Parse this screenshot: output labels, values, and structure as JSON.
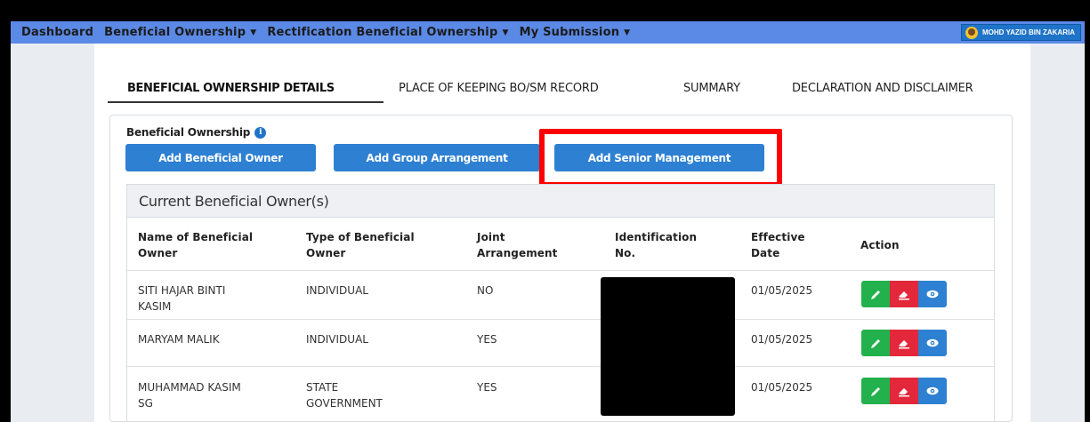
{
  "nav": {
    "items": [
      {
        "label": "Dashboard",
        "dropdown": false
      },
      {
        "label": "Beneficial Ownership",
        "dropdown": true
      },
      {
        "label": "Rectification Beneficial Ownership",
        "dropdown": true
      },
      {
        "label": "My Submission",
        "dropdown": true
      }
    ],
    "user_name": "MOHD YAZID BIN ZAKARIA"
  },
  "tabs": [
    {
      "label": "BENEFICIAL OWNERSHIP DETAILS",
      "active": true
    },
    {
      "label": "PLACE OF KEEPING BO/SM RECORD",
      "active": false
    },
    {
      "label": "SUMMARY",
      "active": false
    },
    {
      "label": "DECLARATION AND DISCLAIMER",
      "active": false
    }
  ],
  "section": {
    "title": "Beneficial Ownership",
    "info_icon": "info-icon",
    "buttons": {
      "add_owner": "Add Beneficial Owner",
      "add_group": "Add Group Arrangement",
      "add_senior": "Add Senior Management"
    }
  },
  "table": {
    "title": "Current Beneficial Owner(s)",
    "headers": {
      "name": [
        "Name of Beneficial",
        "Owner"
      ],
      "type": [
        "Type of Beneficial",
        "Owner"
      ],
      "joint": [
        "Joint",
        "Arrangement"
      ],
      "id": [
        "Identification",
        "No."
      ],
      "date": [
        "Effective",
        "Date"
      ],
      "action": "Action"
    },
    "rows": [
      {
        "name": [
          "SITI HAJAR BINTI",
          "KASIM"
        ],
        "type": [
          "INDIVIDUAL",
          ""
        ],
        "joint": "NO",
        "date": "01/05/2025"
      },
      {
        "name": [
          "MARYAM MALIK",
          ""
        ],
        "type": [
          "INDIVIDUAL",
          ""
        ],
        "joint": "YES",
        "date": "01/05/2025"
      },
      {
        "name": [
          "MUHAMMAD KASIM",
          "SG"
        ],
        "type": [
          "STATE",
          "GOVERNMENT"
        ],
        "joint": "YES",
        "date": "01/05/2025"
      }
    ]
  },
  "colors": {
    "navbar": "#5b89e6",
    "primary": "#2e80d2",
    "edit": "#22b14c",
    "delete": "#e3283b",
    "highlight": "#ff0000"
  }
}
